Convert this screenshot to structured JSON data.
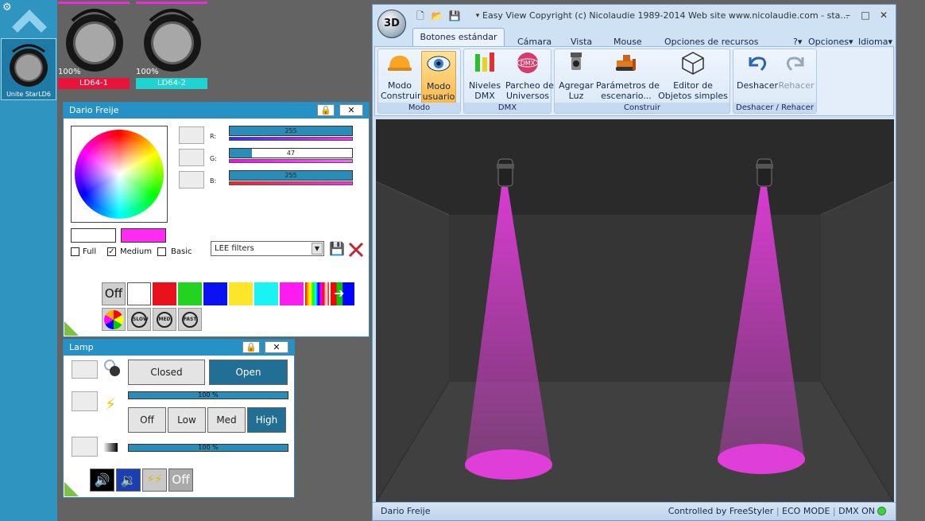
{
  "rail": {
    "settings_icon": "gear-icon",
    "home_icon": "home-chevron-icon",
    "selected_fixture": "Unite StarLD6"
  },
  "fixtures": [
    {
      "percent": "100%",
      "name": "LD64-1",
      "color": "#e8143c"
    },
    {
      "percent": "100%",
      "name": "LD64-2",
      "color": "#1fd3d1"
    }
  ],
  "color_panel": {
    "title": "Dario Freije",
    "channels": [
      {
        "label": "R:",
        "value": "255",
        "level": 1.0
      },
      {
        "label": "G:",
        "value": "47",
        "level": 0.184
      },
      {
        "label": "B:",
        "value": "255",
        "level": 1.0
      }
    ],
    "current_color": "#ff2bf3",
    "checkboxes": [
      {
        "label": "Full",
        "checked": false
      },
      {
        "label": "Medium",
        "checked": true
      },
      {
        "label": "Basic",
        "checked": false
      }
    ],
    "filter_select": "LEE filters",
    "off_label": "Off",
    "swatches": [
      "#ffffff",
      "#e8121d",
      "#22d320",
      "#0a12f2",
      "#fde62a",
      "#19f3f3",
      "#fb1df0"
    ],
    "speed_buttons": [
      "SLOW",
      "MED",
      "FAST"
    ]
  },
  "lamp_panel": {
    "title": "Lamp",
    "closed_label": "Closed",
    "open_label": "Open",
    "level_label": "100 %",
    "power_options": [
      "Off",
      "Low",
      "Med",
      "High"
    ],
    "active_power": "High",
    "dimmer_label": "100 %",
    "off_label": "Off"
  },
  "easy_view": {
    "title": "Easy View   Copyright (c) Nicolaudie 1989-2014   Web site www.nicolaudie.com - sta...",
    "tabs": [
      "Botones estándar",
      "Cámara",
      "Vista",
      "Mouse",
      "Opciones de recursos"
    ],
    "right_menu": [
      "?",
      "Opciones",
      "Idioma"
    ],
    "groups": [
      {
        "name": "Modo",
        "buttons": [
          "Modo\nConstruir",
          "Modo\nusuario"
        ]
      },
      {
        "name": "DMX",
        "buttons": [
          "Niveles\nDMX",
          "Parcheo de\nUniversos"
        ]
      },
      {
        "name": "Construir",
        "buttons": [
          "Agregar\nLuz",
          "Parámetros de\nescenario...",
          "Editor de\nObjetos simples"
        ]
      },
      {
        "name": "Deshacer / Rehacer",
        "buttons": [
          "Deshacer",
          "Rehacer"
        ]
      }
    ],
    "beam_color": "#e03ed8",
    "status_left": "Dario Freije",
    "status_controlled": "Controlled by FreeStyler",
    "status_eco": "ECO MODE",
    "status_dmx": "DMX ON"
  }
}
